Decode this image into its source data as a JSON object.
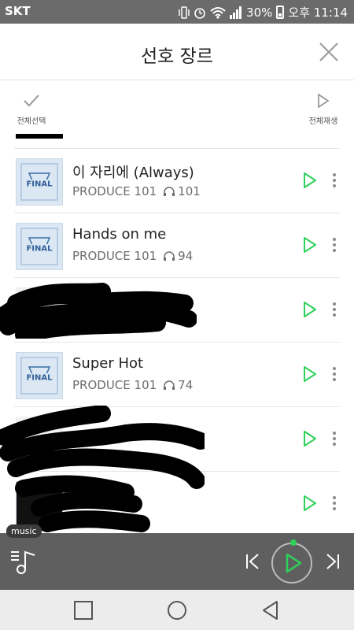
{
  "status_bar": {
    "carrier": "SKT",
    "battery": "30%",
    "time": "오후 11:14",
    "icons": [
      "vibrate-icon",
      "alarm-icon",
      "wifi-icon",
      "signal-icon",
      "battery-icon"
    ]
  },
  "header": {
    "title": "선호 장르",
    "close_icon": "close-icon"
  },
  "toolbar": {
    "select_all_label": "전체선택",
    "play_all_label": "전체재생"
  },
  "songs": [
    {
      "title": "이 자리에 (Always)",
      "artist": "PRODUCE 101",
      "count": "101",
      "album_art": "FINAL"
    },
    {
      "title": "Hands on me",
      "artist": "PRODUCE 101",
      "count": "94",
      "album_art": "FINAL"
    },
    {
      "title": "",
      "artist": "",
      "count": "",
      "album_art": ""
    },
    {
      "title": "Super Hot",
      "artist": "PRODUCE 101",
      "count": "74",
      "album_art": "FINAL"
    },
    {
      "title": "",
      "artist": "",
      "count": "",
      "album_art": ""
    },
    {
      "title": "",
      "artist": "",
      "count": "",
      "album_art": ""
    }
  ],
  "mini_player": {
    "badge": "music"
  },
  "colors": {
    "accent_green": "#2fd15a",
    "status_bar": "#6b6b6b",
    "player_bg": "#5f5f5f"
  }
}
